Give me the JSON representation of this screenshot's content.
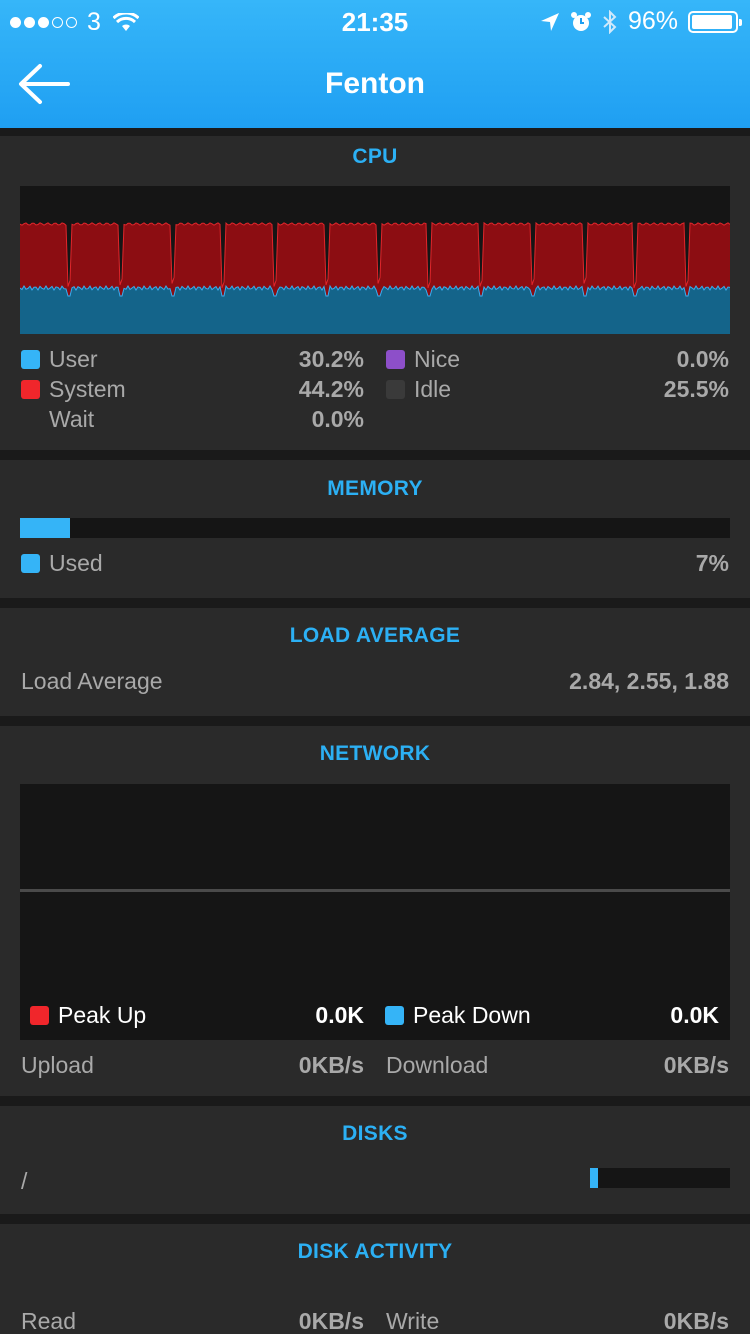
{
  "status_bar": {
    "carrier": "3",
    "time": "21:35",
    "battery": "96%",
    "battery_level": 0.96
  },
  "header": {
    "title": "Fenton"
  },
  "colors": {
    "accent": "#2cb0f4",
    "user": "#35b4f7",
    "system": "#f0262b",
    "nice": "#8d4fc9",
    "idle": "#3a3a3a",
    "cpu_system_area": "#8c0d12",
    "cpu_user_area": "#14648a"
  },
  "cpu": {
    "title": "CPU",
    "stats": [
      {
        "label": "User",
        "value": "30.2%"
      },
      {
        "label": "System",
        "value": "44.2%"
      },
      {
        "label": "Wait",
        "value": "0.0%"
      },
      {
        "label": "Nice",
        "value": "0.0%"
      },
      {
        "label": "Idle",
        "value": "25.5%"
      }
    ]
  },
  "memory": {
    "title": "MEMORY",
    "label": "Used",
    "value": "7%",
    "fraction": 0.07
  },
  "load": {
    "title": "LOAD AVERAGE",
    "label": "Load Average",
    "value": "2.84, 2.55, 1.88"
  },
  "network": {
    "title": "NETWORK",
    "peak_up_label": "Peak Up",
    "peak_up_value": "0.0K",
    "peak_down_label": "Peak Down",
    "peak_down_value": "0.0K",
    "upload_label": "Upload",
    "upload_value": "0KB/s",
    "download_label": "Download",
    "download_value": "0KB/s"
  },
  "disks": {
    "title": "DISKS",
    "label": "/",
    "fraction": 0.06
  },
  "disk_activity": {
    "title": "DISK ACTIVITY",
    "read_label": "Read",
    "read_value": "0KB/s",
    "write_label": "Write",
    "write_value": "0KB/s"
  }
}
